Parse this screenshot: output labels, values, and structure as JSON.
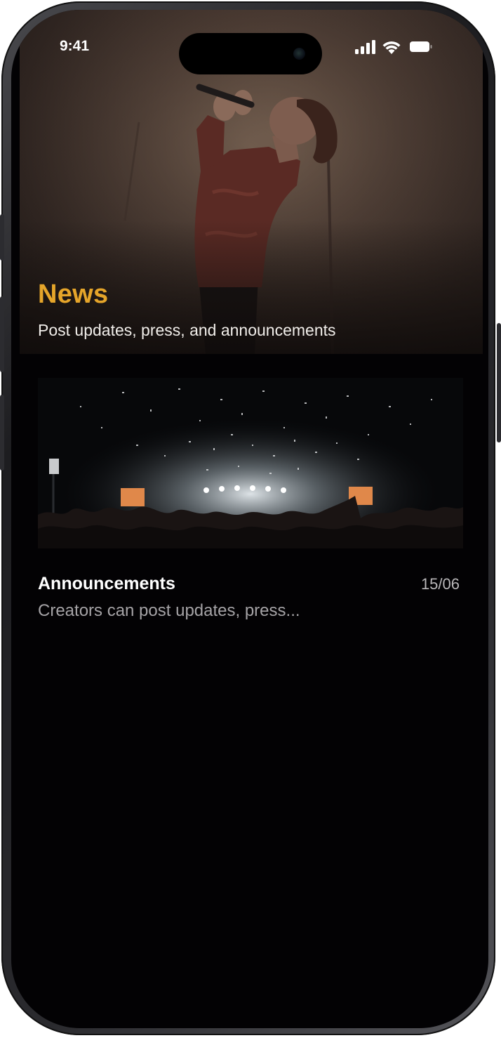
{
  "status_bar": {
    "time": "9:41",
    "icons": [
      "cellular-signal-icon",
      "wifi-icon",
      "battery-icon"
    ]
  },
  "header": {
    "title": "News",
    "subtitle": "Post updates, press, and announcements",
    "title_color": "#e5a52a"
  },
  "news_items": [
    {
      "title": "Announcements",
      "date": "15/06",
      "excerpt": "Creators can post updates, press..."
    }
  ],
  "colors": {
    "background": "#030204",
    "accent": "#e5a52a",
    "text_primary": "#ffffff",
    "text_secondary": "#a5a3a6"
  }
}
